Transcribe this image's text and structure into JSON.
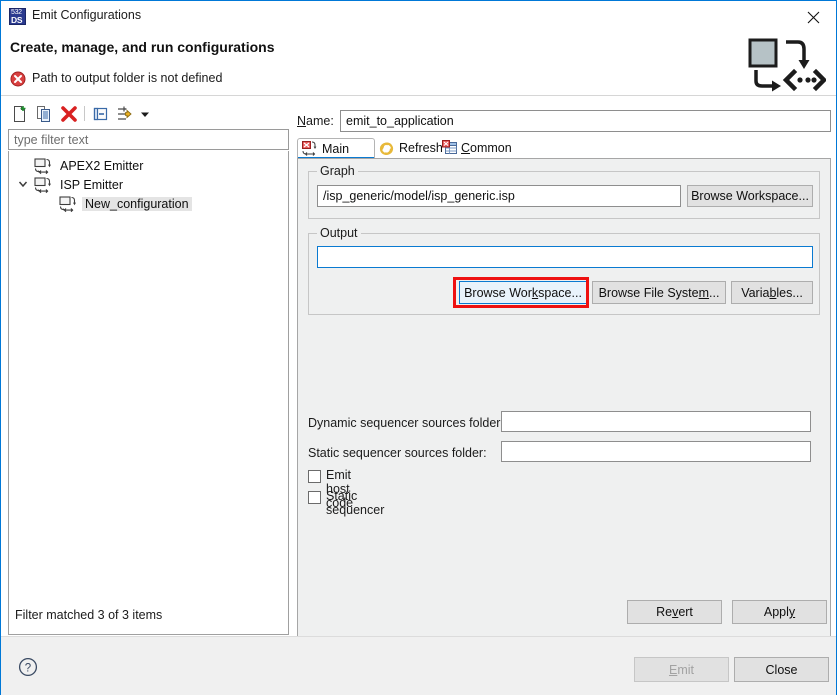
{
  "window": {
    "title": "Emit Configurations",
    "icon": "emit-configurations-icon",
    "icon_text_top": "532",
    "icon_text_bottom": "DS",
    "close_icon": "close-icon"
  },
  "header": {
    "title": "Create, manage, and run configurations",
    "error_icon": "error-icon",
    "error_text": "Path to output folder is not defined",
    "banner_icon": "emit-banner-icon"
  },
  "left_panel": {
    "toolbar": [
      {
        "name": "new-configuration-icon",
        "tooltip": "New launch configuration"
      },
      {
        "name": "duplicate-configuration-icon",
        "tooltip": "Duplicate currently selected launch configuration"
      },
      {
        "name": "delete-configuration-icon",
        "tooltip": "Delete selected launch configuration(s)"
      },
      {
        "name": "collapse-all-icon",
        "tooltip": "Collapse All"
      },
      {
        "name": "filter-icon",
        "tooltip": "Filter launch configurations"
      },
      {
        "name": "chevron-down-icon",
        "tooltip": "Menu"
      }
    ],
    "filter": {
      "value": "",
      "placeholder": "type filter text"
    },
    "tree": [
      {
        "label": "APEX2 Emitter",
        "level": 0,
        "expanded": false,
        "selected": false,
        "has_twisty": false,
        "icon": "emitter-icon"
      },
      {
        "label": "ISP Emitter",
        "level": 0,
        "expanded": true,
        "selected": false,
        "has_twisty": true,
        "icon": "emitter-icon"
      },
      {
        "label": "New_configuration",
        "level": 1,
        "expanded": false,
        "selected": true,
        "has_twisty": false,
        "icon": "emitter-icon"
      }
    ],
    "status": "Filter matched 3 of 3 items"
  },
  "right_panel": {
    "name_label": "Name:",
    "name_mnemonic": "N",
    "name_value": "emit_to_application",
    "tabs": [
      {
        "label": "Main",
        "icon": "main-tab-icon",
        "selected": true,
        "mnemonic": ""
      },
      {
        "label": "Refresh",
        "icon": "refresh-tab-icon",
        "selected": false,
        "mnemonic": ""
      },
      {
        "label": "Common",
        "icon": "common-tab-icon",
        "selected": false,
        "mnemonic": "C"
      }
    ],
    "graph_group": {
      "legend": "Graph",
      "path_value": "/isp_generic/model/isp_generic.isp",
      "browse_button": {
        "label": "Browse Workspace...",
        "mnemonic": ""
      }
    },
    "output_group": {
      "legend": "Output",
      "path_value": "",
      "path_focused": true,
      "buttons": [
        {
          "label": "Browse Workspace...",
          "mnemonic": "k",
          "focused": true,
          "highlighted": true
        },
        {
          "label": "Browse File System...",
          "mnemonic": "m",
          "focused": false,
          "highlighted": false
        },
        {
          "label": "Variables...",
          "mnemonic": "b",
          "focused": false,
          "highlighted": false
        }
      ]
    },
    "fields": [
      {
        "label": "Dynamic sequencer sources folder:",
        "value": ""
      },
      {
        "label": "Static sequencer sources folder:",
        "value": ""
      }
    ],
    "checkboxes": [
      {
        "label": "Emit host code",
        "checked": false
      },
      {
        "label": "Static sequencer",
        "checked": false
      }
    ],
    "revert_button": {
      "label": "Revert",
      "mnemonic": "v"
    },
    "apply_button": {
      "label": "Apply",
      "mnemonic": "y"
    }
  },
  "footer": {
    "help_icon": "help-icon",
    "emit_button": {
      "label": "Emit",
      "mnemonic": "E",
      "disabled": true
    },
    "close_button": {
      "label": "Close",
      "disabled": false
    }
  },
  "colors": {
    "accent_blue": "#0a7ad1",
    "highlight_red": "#ee1111",
    "panel_bg": "#eff0f0",
    "button_bg": "#e1e1e1"
  }
}
